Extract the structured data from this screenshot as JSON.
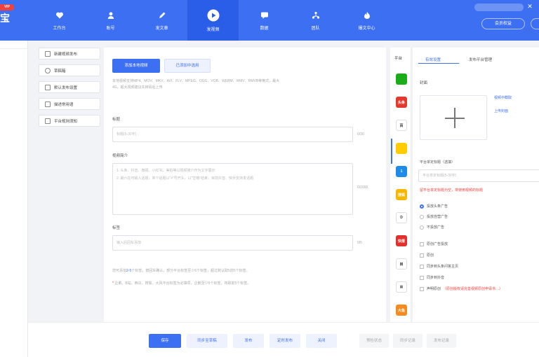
{
  "app": {
    "logo_badge": "VIP",
    "logo_text": "宝",
    "member_button": "会员权益"
  },
  "nav": [
    {
      "label": "工作台",
      "icon": "heart-icon"
    },
    {
      "label": "账号",
      "icon": "user-icon"
    },
    {
      "label": "发文章",
      "icon": "pen-icon"
    },
    {
      "label": "发视频",
      "icon": "play-icon",
      "active": true
    },
    {
      "label": "数据",
      "icon": "chat-icon"
    },
    {
      "label": "团队",
      "icon": "team-icon"
    },
    {
      "label": "爆文中心",
      "icon": "fire-icon"
    }
  ],
  "tools": [
    {
      "label": "新建视频发布",
      "icon": "new-icon"
    },
    {
      "label": "草稿箱",
      "icon": "draft-icon"
    },
    {
      "label": "默认发布设置",
      "icon": "settings-icon"
    },
    {
      "label": "描述常用语",
      "icon": "phrase-icon"
    },
    {
      "label": "平台规则须知",
      "icon": "rules-icon"
    }
  ],
  "form": {
    "add_local_video": "添加本地视频",
    "select_from_library": "已添加中选用",
    "format_hint_line1": "本地视频支持MP4、MOV、MKV、AVI、FLV、MPEG、OGG、VOB、WEBM、WMV、RMVB等格式，最大",
    "format_hint_line2": "4G，超大视频建议先转码后上传",
    "title_label": "标题",
    "title_placeholder": "标题(5-30字)",
    "title_counter": "0/30",
    "desc_label": "视频简介",
    "desc_placeholder_line1": "1. 头条、抖音、微视、小红书、美拍等以视频简介作为文字展示",
    "desc_placeholder_line2": "2. 最六在可输入话题，单个话题以“#”号开头，以“空格”结束，目前抖音、快手支持发话题",
    "desc_counter": "0/2000",
    "tags_label": "标签",
    "tags_placeholder": "输入后回车添加",
    "tags_counter": "0/5",
    "tag_hint_1_pre": "您可添加",
    "tag_hint_1_hl": "2-5",
    "tag_hint_1_post": "个标签，按回车确认，部分平台标签至少6个标签，超过默认取5前5个标签。",
    "tag_hint_2_mark": "*",
    "tag_hint_2_text": "企鹅、B站、西瓜、搜狐、大风平台标签为必填项，企鹅至少5个标签，将取前5个标签。"
  },
  "platforms": {
    "title": "平台",
    "items": [
      {
        "name": "wechat",
        "color": "#1aad19",
        "glyph": ""
      },
      {
        "name": "toutiao",
        "color": "#e33a2e",
        "glyph": "头条"
      },
      {
        "name": "baijiahao",
        "color": "#ffffff",
        "glyph": "百"
      },
      {
        "name": "kuaishou",
        "color": "#ffcc00",
        "glyph": ""
      },
      {
        "name": "yidian",
        "color": "#1e8bea",
        "glyph": "1"
      },
      {
        "name": "sohu",
        "color": "#f5b700",
        "glyph": "搜狐"
      },
      {
        "name": "weibo",
        "color": "#ffffff",
        "glyph": "D"
      },
      {
        "name": "kuaibao",
        "color": "#e2302c",
        "glyph": "快报"
      },
      {
        "name": "aiqiyi",
        "color": "#ffffff",
        "glyph": "目"
      },
      {
        "name": "multi",
        "color": "#ffffff",
        "glyph": "▦"
      },
      {
        "name": "dayu",
        "color": "#f58b1f",
        "glyph": "大鱼"
      }
    ]
  },
  "settings": {
    "tab_video": "有效设置",
    "tab_publish": "发布平台管理",
    "cover_label": "封面",
    "cover_link_1": "视频中截取",
    "cover_link_2": "上传封面",
    "custom_title_label": "平台单定标题（选填）",
    "custom_title_placeholder": "平台单定标题(5-30字)",
    "warn_1": "留平台单定标题为空，将使用视频的标题",
    "ad_options": [
      "投放头条广告",
      "投放自营广告",
      "不投放广告"
    ],
    "ad_selected": 0,
    "checkboxes": [
      "原创广告投放",
      "原创",
      "同步到头条问答主页",
      "同步到抖音",
      "声明原创"
    ],
    "warn_2": "（原创版权请完善视频原创申请书…）"
  },
  "footer": {
    "save": "保存",
    "sync_draft": "同步至草稿",
    "publish": "发布",
    "schedule": "定时发布",
    "close": "关闭",
    "preview": "预检状态",
    "sync_record": "同步记录",
    "publish_record": "发布记录"
  },
  "colors": {
    "brand": "#3d6ff2",
    "danger": "#f2413c"
  }
}
